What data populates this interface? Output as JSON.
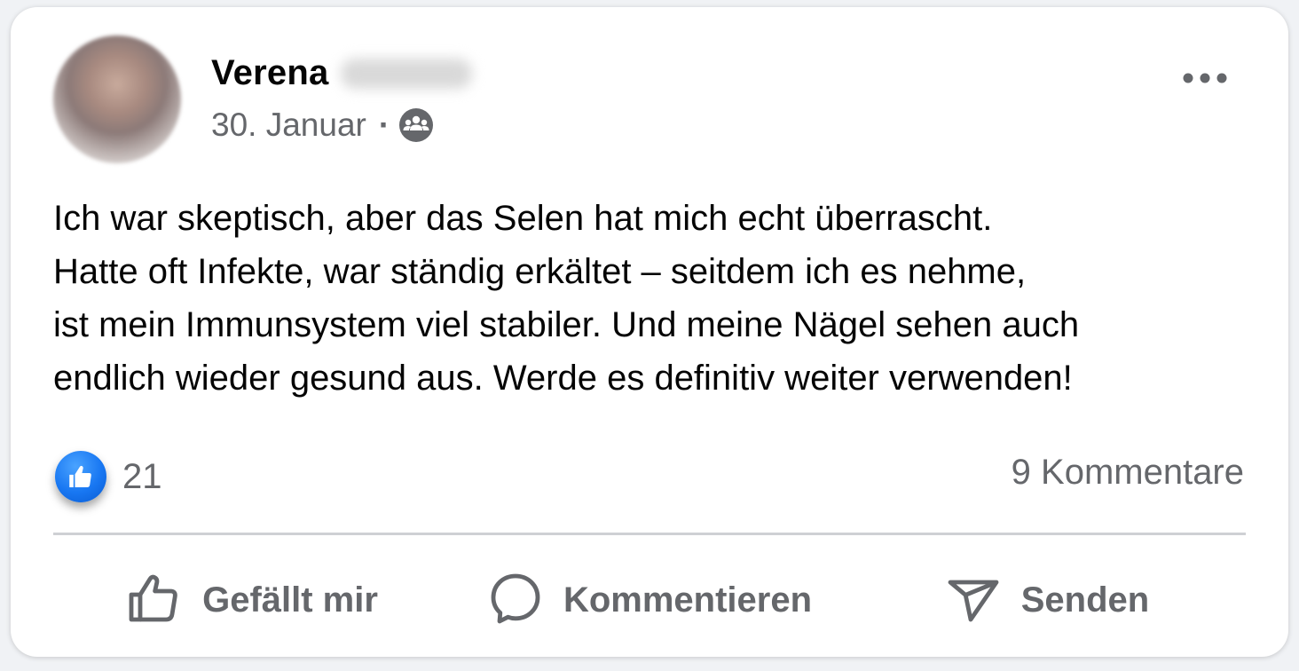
{
  "post": {
    "author": {
      "first_name": "Verena",
      "last_name_redacted": true
    },
    "date": "30. Januar",
    "separator": "·",
    "audience_icon": "group-icon",
    "more_icon": "more-horizontal-icon",
    "text_lines": [
      "Ich war skeptisch, aber das Selen hat mich echt überrascht.",
      "Hatte oft Infekte, war ständig erkältet – seitdem ich es nehme,",
      "ist mein Immunsystem viel stabiler. Und meine Nägel sehen auch",
      "endlich wieder gesund aus. Werde es definitiv weiter verwenden!"
    ],
    "reactions": {
      "icon": "thumbs-up-icon",
      "count": "21"
    },
    "comments_label": "9 Kommentare"
  },
  "actions": {
    "like_label": "Gefällt mir",
    "comment_label": "Kommentieren",
    "send_label": "Senden"
  },
  "colors": {
    "accent": "#1877f2",
    "secondary_text": "#65676b",
    "primary_text": "#050505",
    "divider": "#ced0d4"
  }
}
